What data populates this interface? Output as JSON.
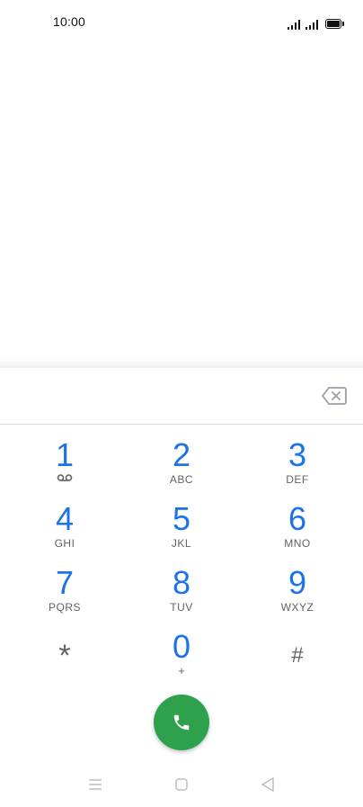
{
  "status_bar": {
    "time": "10:00"
  },
  "dialer": {
    "number_value": "",
    "keys": [
      {
        "digit": "1",
        "letters": ""
      },
      {
        "digit": "2",
        "letters": "ABC"
      },
      {
        "digit": "3",
        "letters": "DEF"
      },
      {
        "digit": "4",
        "letters": "GHI"
      },
      {
        "digit": "5",
        "letters": "JKL"
      },
      {
        "digit": "6",
        "letters": "MNO"
      },
      {
        "digit": "7",
        "letters": "PQRS"
      },
      {
        "digit": "8",
        "letters": "TUV"
      },
      {
        "digit": "9",
        "letters": "WXYZ"
      },
      {
        "digit": "*",
        "letters": ""
      },
      {
        "digit": "0",
        "letters": "+"
      },
      {
        "digit": "#",
        "letters": ""
      }
    ]
  },
  "colors": {
    "digit": "#1a73e8",
    "letters": "#5f6368",
    "call_button": "#2fa14d"
  },
  "icons": {
    "status": [
      "signal-icon",
      "signal-icon",
      "battery-icon"
    ],
    "key_1": "voicemail-icon",
    "backspace": "backspace-icon",
    "call": "phone-icon",
    "nav": [
      "menu-icon",
      "home-icon",
      "back-icon"
    ]
  }
}
